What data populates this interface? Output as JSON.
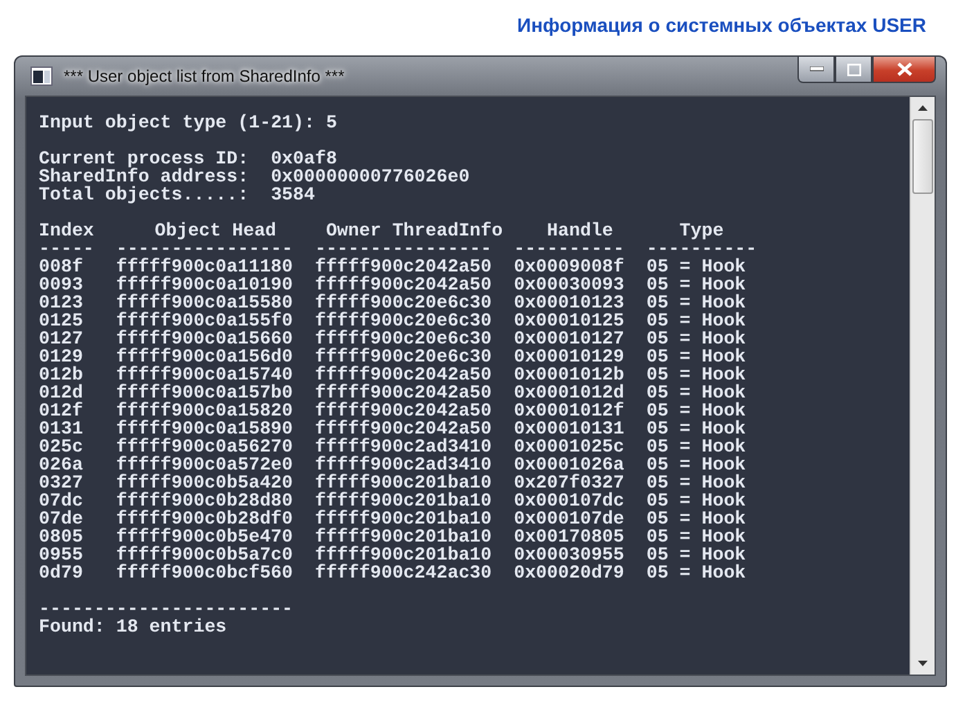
{
  "page_title": "Информация о системных объектах USER",
  "window": {
    "title": "*** User object list from SharedInfo ***"
  },
  "console": {
    "prompt": "Input object type (1-21): 5",
    "info": [
      {
        "label": "Current process ID:",
        "value": "0x0af8"
      },
      {
        "label": "SharedInfo address:",
        "value": "0x00000000776026e0"
      },
      {
        "label": "Total objects.....:",
        "value": "3584"
      }
    ],
    "table": {
      "columns": [
        {
          "label": "Index",
          "rule": "-----"
        },
        {
          "label": "Object Head",
          "rule": "----------------"
        },
        {
          "label": "Owner ThreadInfo",
          "rule": "----------------"
        },
        {
          "label": "Handle",
          "rule": "----------"
        },
        {
          "label": "Type",
          "rule": "----------"
        }
      ],
      "rows": [
        [
          "008f",
          "fffff900c0a11180",
          "fffff900c2042a50",
          "0x0009008f",
          "05 = Hook"
        ],
        [
          "0093",
          "fffff900c0a10190",
          "fffff900c2042a50",
          "0x00030093",
          "05 = Hook"
        ],
        [
          "0123",
          "fffff900c0a15580",
          "fffff900c20e6c30",
          "0x00010123",
          "05 = Hook"
        ],
        [
          "0125",
          "fffff900c0a155f0",
          "fffff900c20e6c30",
          "0x00010125",
          "05 = Hook"
        ],
        [
          "0127",
          "fffff900c0a15660",
          "fffff900c20e6c30",
          "0x00010127",
          "05 = Hook"
        ],
        [
          "0129",
          "fffff900c0a156d0",
          "fffff900c20e6c30",
          "0x00010129",
          "05 = Hook"
        ],
        [
          "012b",
          "fffff900c0a15740",
          "fffff900c2042a50",
          "0x0001012b",
          "05 = Hook"
        ],
        [
          "012d",
          "fffff900c0a157b0",
          "fffff900c2042a50",
          "0x0001012d",
          "05 = Hook"
        ],
        [
          "012f",
          "fffff900c0a15820",
          "fffff900c2042a50",
          "0x0001012f",
          "05 = Hook"
        ],
        [
          "0131",
          "fffff900c0a15890",
          "fffff900c2042a50",
          "0x00010131",
          "05 = Hook"
        ],
        [
          "025c",
          "fffff900c0a56270",
          "fffff900c2ad3410",
          "0x0001025c",
          "05 = Hook"
        ],
        [
          "026a",
          "fffff900c0a572e0",
          "fffff900c2ad3410",
          "0x0001026a",
          "05 = Hook"
        ],
        [
          "0327",
          "fffff900c0b5a420",
          "fffff900c201ba10",
          "0x207f0327",
          "05 = Hook"
        ],
        [
          "07dc",
          "fffff900c0b28d80",
          "fffff900c201ba10",
          "0x000107dc",
          "05 = Hook"
        ],
        [
          "07de",
          "fffff900c0b28df0",
          "fffff900c201ba10",
          "0x000107de",
          "05 = Hook"
        ],
        [
          "0805",
          "fffff900c0b5e470",
          "fffff900c201ba10",
          "0x00170805",
          "05 = Hook"
        ],
        [
          "0955",
          "fffff900c0b5a7c0",
          "fffff900c201ba10",
          "0x00030955",
          "05 = Hook"
        ],
        [
          "0d79",
          "fffff900c0bcf560",
          "fffff900c242ac30",
          "0x00020d79",
          "05 = Hook"
        ]
      ]
    },
    "footer_rule": "-----------------------",
    "summary": "Found: 18 entries"
  }
}
